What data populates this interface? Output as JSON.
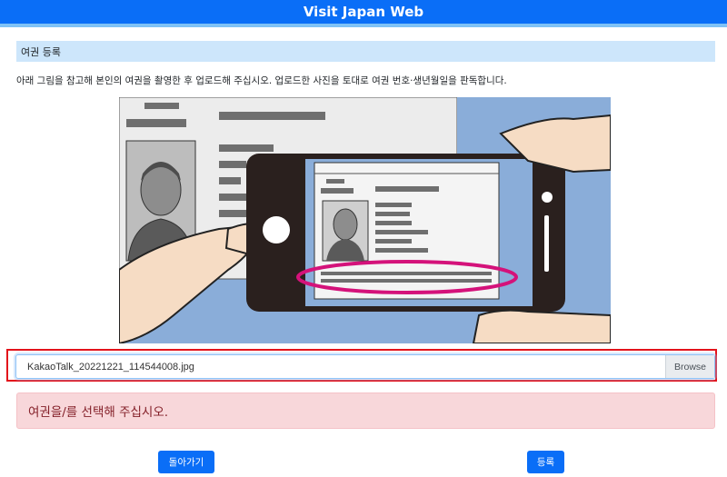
{
  "header": {
    "title": "Visit Japan Web"
  },
  "section": {
    "title": "여권 등록",
    "instruction": "아래 그림을 참고해 본인의 여권을 촬영한 후 업로드해 주십시오. 업로드한 사진을 토대로 여권 번호·생년월일을 판독합니다."
  },
  "upload": {
    "file_name": "KakaoTalk_20221221_114544008.jpg",
    "browse_label": "Browse"
  },
  "alert": {
    "message": "여권을/를 선택해 주십시오."
  },
  "buttons": {
    "back_label": "돌아가기",
    "register_label": "등록"
  },
  "colors": {
    "primary": "#0a6ef7",
    "header_stripe": "#7fc2f6",
    "section_bg": "#cde6fb",
    "alert_bg": "#f8d7da",
    "alert_text": "#842029",
    "highlight_frame": "#e3131b",
    "ellipse_magenta": "#d4127a"
  }
}
